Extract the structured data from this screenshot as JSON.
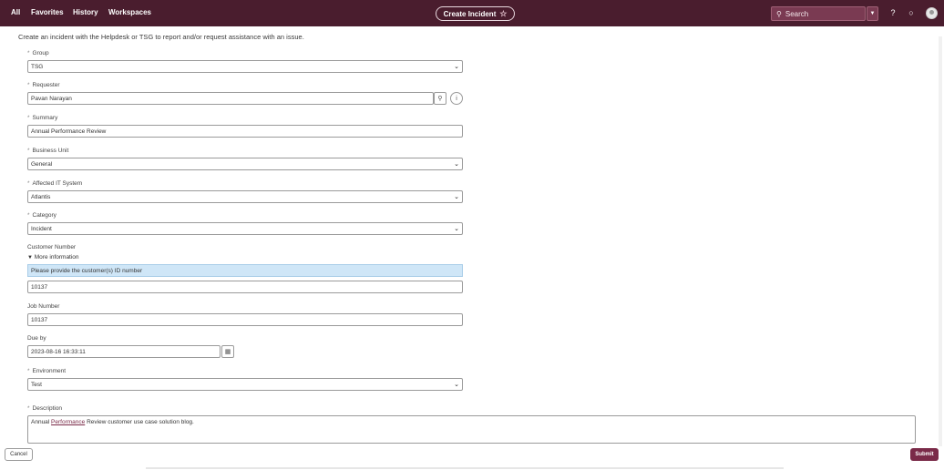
{
  "nav": {
    "all": "All",
    "favorites": "Favorites",
    "history": "History",
    "workspaces": "Workspaces",
    "create_label": "Create Incident",
    "search_placeholder": "Search"
  },
  "intro": "Create an incident with the Helpdesk or TSG to report and/or request assistance with an issue.",
  "fields": {
    "group": {
      "label": "Group",
      "value": "TSG"
    },
    "requester": {
      "label": "Requester",
      "value": "Pavan Narayan"
    },
    "summary": {
      "label": "Summary",
      "value": "Annual Performance Review"
    },
    "business_unit": {
      "label": "Business Unit",
      "value": "General"
    },
    "affected_it_system": {
      "label": "Affected IT System",
      "value": "Atlantis"
    },
    "category": {
      "label": "Category",
      "value": "Incident"
    },
    "customer_number": {
      "label": "Customer Number",
      "more_info": "More information",
      "info_text": "Please provide the customer(s) ID number",
      "value": "10137"
    },
    "job_number": {
      "label": "Job Number",
      "value": "10137"
    },
    "due_by": {
      "label": "Due by",
      "value": "2023-08-16 16:33:11"
    },
    "environment": {
      "label": "Environment",
      "value": "Test"
    },
    "description": {
      "label": "Description",
      "prefix": "Annual ",
      "link": "Performance",
      "suffix": " Review customer use case solution blog."
    }
  },
  "buttons": {
    "cancel": "Cancel",
    "submit": "Submit"
  }
}
